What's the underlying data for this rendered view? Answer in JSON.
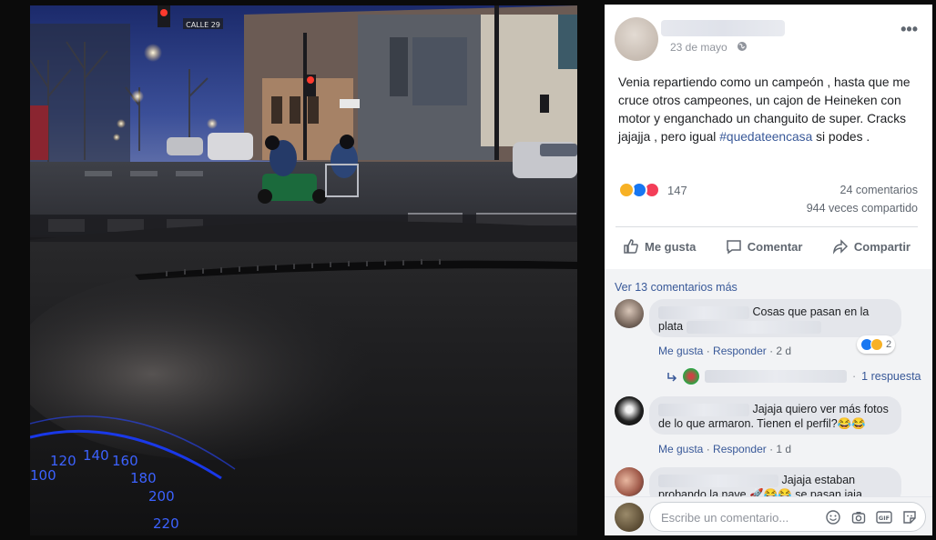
{
  "post": {
    "date": "23 de mayo",
    "text_main": "Venia repartiendo como un campeón , hasta que me cruce otros campeones, un cajon de Heineken con motor y enganchado un changuito de super. Cracks jajajja , pero igual ",
    "hashtag": "#quedateencasa",
    "text_tail": " si podes .",
    "more_label": "•••"
  },
  "stats": {
    "reaction_count": "147",
    "comments": "24 comentarios",
    "shares": "944 veces compartido"
  },
  "actions": {
    "like": "Me gusta",
    "comment": "Comentar",
    "share": "Compartir"
  },
  "comments": {
    "view_more": "Ver 13 comentarios más",
    "items": [
      {
        "text_a": "Cosas que pasan en la",
        "text_b": "plata",
        "like": "Me gusta",
        "reply": "Responder",
        "time": "2 d",
        "reaction_count": "2"
      },
      {
        "text_a": "Jajaja quiero ver más fotos",
        "text_b": "de lo que armaron. Tienen el perfil?",
        "emoji": "😂😂",
        "like": "Me gusta",
        "reply": "Responder",
        "time": "1 d"
      },
      {
        "text_a": "Jajaja estaban",
        "text_b": "probando la nave 🚀😂😂 se pasan jaja"
      }
    ],
    "replies": "1 respuesta"
  },
  "composer": {
    "placeholder": "Escribe un comentario..."
  },
  "photo": {
    "street_sign": "CALLE 29",
    "speedo_ticks": [
      "100",
      "120",
      "140",
      "160",
      "180",
      "200",
      "220"
    ]
  },
  "colors": {
    "link": "#385898",
    "like_blue": "#1877f2",
    "love_red": "#f33e58",
    "haha_yellow": "#f7b125"
  }
}
